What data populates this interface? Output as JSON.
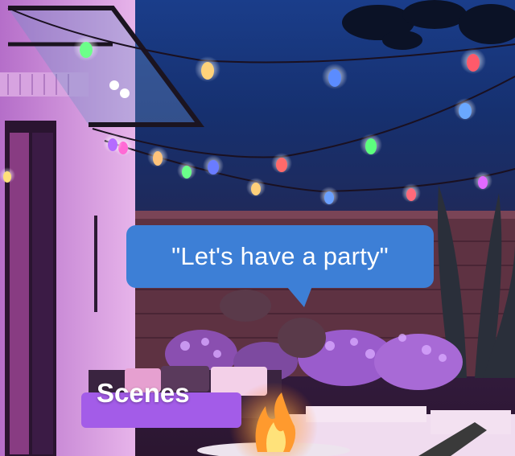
{
  "photo": {
    "subject": "backyard-string-lights-at-dusk",
    "colors": {
      "sky": "#1d3f8f",
      "wall": "#c78bd8",
      "fence": "#6b3a4a",
      "flowers": "#c98cf0",
      "fire": "#ffb347"
    }
  },
  "speech_bubble": {
    "text": "\"Let's have a party\"",
    "color": "#3d7fd6"
  },
  "feature_label": {
    "text": "Scenes",
    "color": "#a35ce8"
  }
}
